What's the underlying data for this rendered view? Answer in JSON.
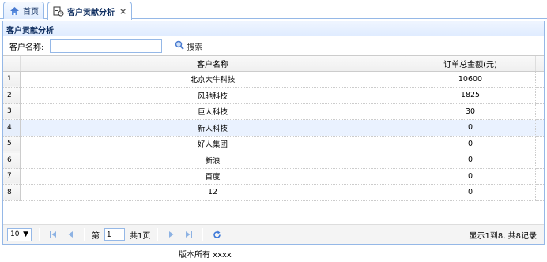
{
  "tabs": [
    {
      "label": "首页",
      "icon": "home-icon"
    },
    {
      "label": "客户贡献分析",
      "icon": "report-icon",
      "close": "×"
    }
  ],
  "panel": {
    "title": "客户贡献分析"
  },
  "search": {
    "label": "客户名称:",
    "value": "",
    "placeholder": "",
    "button": "搜索"
  },
  "table": {
    "columns": [
      "客户名称",
      "订单总金额(元)"
    ],
    "rows": [
      {
        "num": "1",
        "name": "北京大牛科技",
        "amount": "10600"
      },
      {
        "num": "2",
        "name": "风驰科技",
        "amount": "1825"
      },
      {
        "num": "3",
        "name": "巨人科技",
        "amount": "30"
      },
      {
        "num": "4",
        "name": "新人科技",
        "amount": "0"
      },
      {
        "num": "5",
        "name": "好人集团",
        "amount": "0"
      },
      {
        "num": "6",
        "name": "新浪",
        "amount": "0"
      },
      {
        "num": "7",
        "name": "百度",
        "amount": "0"
      },
      {
        "num": "8",
        "name": "12",
        "amount": "0"
      }
    ],
    "hover_row": 4
  },
  "pager": {
    "page_size": "10",
    "page_prefix": "第",
    "page_value": "1",
    "page_suffix": "共1页",
    "info": "显示1到8, 共8记录"
  },
  "footer": {
    "text": "版本所有 xxxx"
  },
  "colors": {
    "border": "#95b8e7",
    "header_text": "#0e2d5f",
    "hover_row": "#eaf2ff"
  }
}
